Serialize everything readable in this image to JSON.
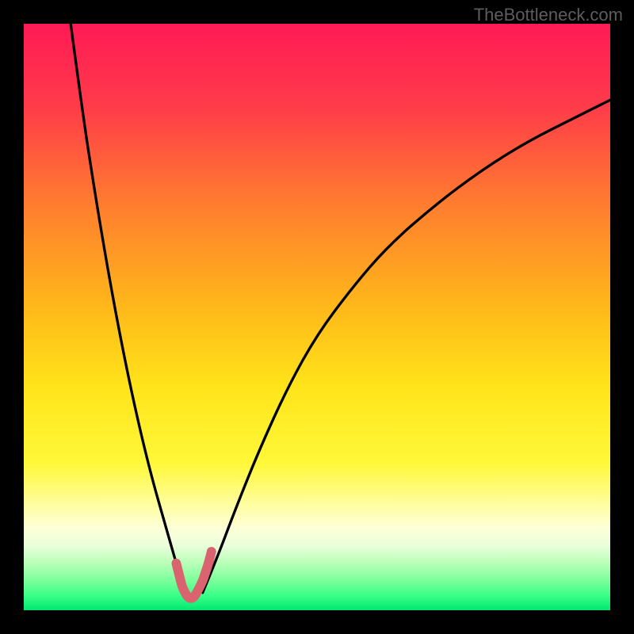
{
  "watermark": "TheBottleneck.com",
  "chart_data": {
    "type": "line",
    "title": "",
    "xlabel": "",
    "ylabel": "",
    "xlim": [
      0,
      100
    ],
    "ylim": [
      0,
      100
    ],
    "curves": {
      "left": {
        "x": [
          8,
          10,
          12,
          14,
          16,
          18,
          20,
          22,
          24,
          26,
          27.5
        ],
        "y": [
          100,
          85,
          72,
          60,
          49,
          39,
          30,
          22,
          15,
          8,
          3
        ]
      },
      "right": {
        "x": [
          30.5,
          33,
          36,
          40,
          45,
          50,
          56,
          62,
          70,
          78,
          86,
          94,
          100
        ],
        "y": [
          3,
          9,
          17,
          27,
          38,
          47,
          55,
          62,
          69,
          75,
          80,
          84,
          87
        ]
      },
      "trough_marker": {
        "x": [
          26,
          26.5,
          27,
          27.5,
          28,
          28.5,
          29,
          29.5,
          30,
          30.5,
          31,
          31.5,
          32
        ],
        "y": [
          8,
          6,
          4,
          3,
          2.2,
          2,
          2.2,
          3,
          4,
          5,
          6.5,
          8,
          10
        ]
      }
    },
    "gradient_stops": [
      {
        "pos": 0.0,
        "color": "#ff1a55"
      },
      {
        "pos": 0.14,
        "color": "#ff3b4a"
      },
      {
        "pos": 0.3,
        "color": "#ff7a30"
      },
      {
        "pos": 0.48,
        "color": "#ffb71a"
      },
      {
        "pos": 0.62,
        "color": "#ffe41a"
      },
      {
        "pos": 0.75,
        "color": "#fff83a"
      },
      {
        "pos": 0.82,
        "color": "#fffea0"
      },
      {
        "pos": 0.86,
        "color": "#fdffd8"
      },
      {
        "pos": 0.89,
        "color": "#eaffda"
      },
      {
        "pos": 0.92,
        "color": "#b8ffb8"
      },
      {
        "pos": 0.95,
        "color": "#7aff9a"
      },
      {
        "pos": 0.975,
        "color": "#3aff88"
      },
      {
        "pos": 1.0,
        "color": "#00e870"
      }
    ],
    "trough_color": "#d9636e",
    "trough_x_pct": 29
  }
}
